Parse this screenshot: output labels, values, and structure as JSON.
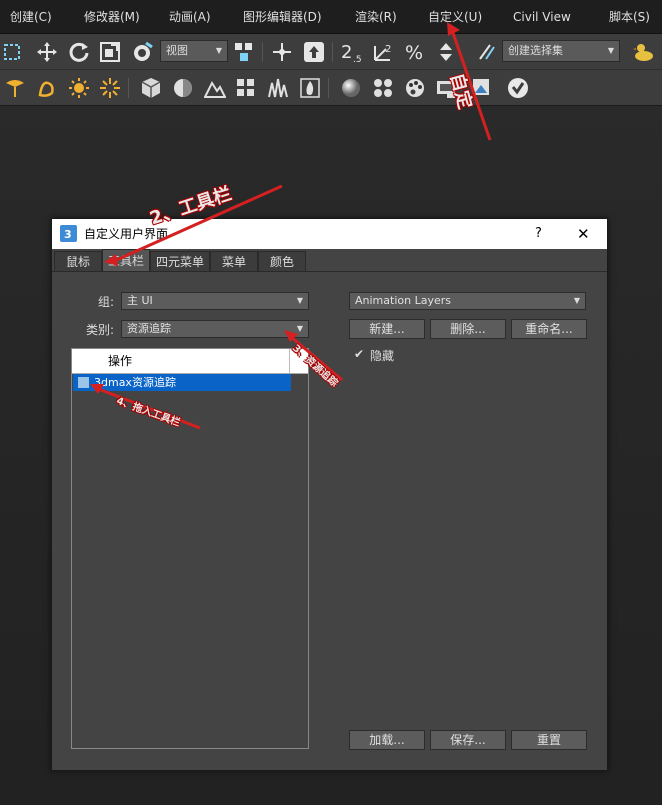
{
  "menubar": {
    "items": [
      "创建(C)",
      "修改器(M)",
      "动画(A)",
      "图形编辑器(D)",
      "渲染(R)",
      "自定义(U)",
      "Civil View",
      "脚本(S)"
    ]
  },
  "toolbar1": {
    "view_combo": "视图",
    "selection_set_combo": "创建选择集"
  },
  "dialog": {
    "title": "自定义用户界面",
    "help": "?",
    "close": "✕",
    "tabs": [
      "鼠标",
      "工具栏",
      "四元菜单",
      "菜单",
      "颜色"
    ],
    "active_tab": 1,
    "group_label": "组:",
    "group_value": "主 UI",
    "category_label": "类别:",
    "category_value": "资源追踪",
    "list_header": "操作",
    "list_item": "3dmax资源追踪",
    "toolbar_combo": "Animation Layers",
    "new_button": "新建...",
    "delete_button": "删除...",
    "rename_button": "重命名...",
    "hide_checkbox_label": "隐藏",
    "hide_checked": true,
    "load_button": "加载...",
    "save_button": "保存...",
    "reset_button": "重置"
  },
  "annotations": {
    "a1": "自定",
    "a2": "2、工具栏",
    "a3": "3、资源追踪",
    "a4": "4、拖入工具栏"
  },
  "colors": {
    "accent_red": "#d42020",
    "selection_blue": "#0a64c8"
  }
}
